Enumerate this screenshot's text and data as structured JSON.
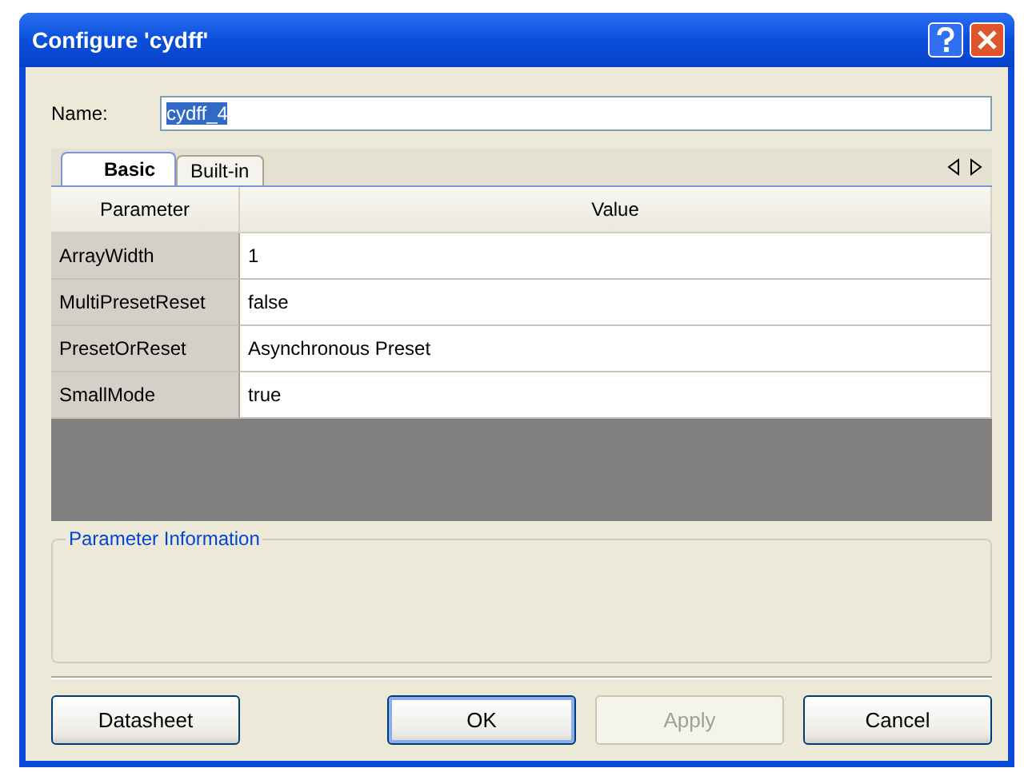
{
  "window": {
    "title": "Configure 'cydff'"
  },
  "name_field": {
    "label": "Name:",
    "value": "cydff_4",
    "text_selected": true
  },
  "tabs": [
    {
      "label": "Basic",
      "selected": true
    },
    {
      "label": "Built-in",
      "selected": false
    }
  ],
  "table": {
    "columns": [
      "Parameter",
      "Value"
    ],
    "rows": [
      {
        "parameter": "ArrayWidth",
        "value": "1"
      },
      {
        "parameter": "MultiPresetReset",
        "value": "false"
      },
      {
        "parameter": "PresetOrReset",
        "value": "Asynchronous Preset"
      },
      {
        "parameter": "SmallMode",
        "value": "true"
      }
    ]
  },
  "info_group": {
    "title": "Parameter Information"
  },
  "buttons": [
    {
      "label": "Datasheet",
      "disabled": false,
      "default": false
    },
    {
      "label": "OK",
      "disabled": false,
      "default": true
    },
    {
      "label": "Apply",
      "disabled": true,
      "default": false
    },
    {
      "label": "Cancel",
      "disabled": false,
      "default": false
    }
  ]
}
